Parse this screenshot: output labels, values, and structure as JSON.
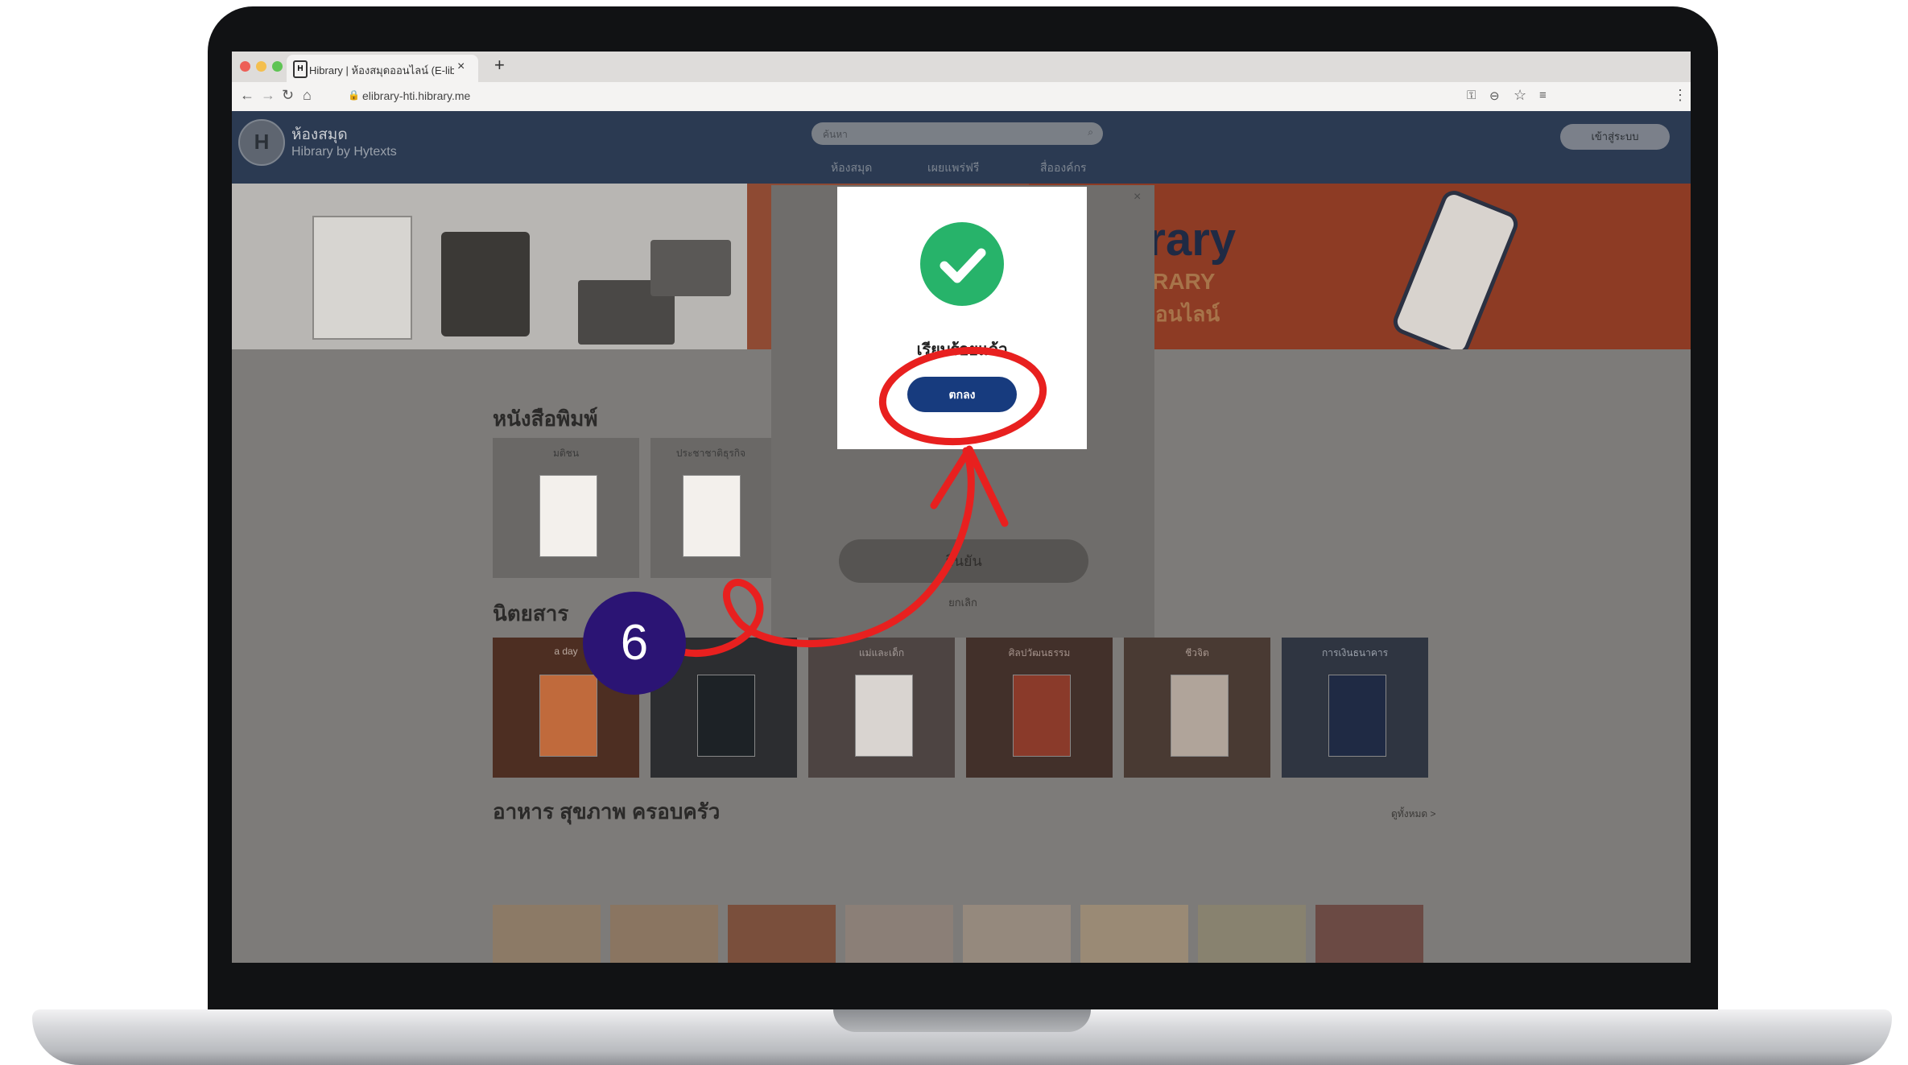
{
  "browser": {
    "tab_title": "Hibrary | ห้องสมุดออนไลน์ (E-lib",
    "url": "elibrary-hti.hibrary.me",
    "new_tab": "+",
    "close": "×",
    "favicon": "H"
  },
  "site": {
    "logo_letter": "H",
    "name": "ห้องสมุด",
    "subtitle": "Hibrary by Hytexts",
    "search_placeholder": "ค้นหา",
    "nav": [
      "ห้องสมุด",
      "เผยแพร่ฟรี",
      "สื่อองค์กร"
    ],
    "login_label": "เข้าสู่ระบบ"
  },
  "banner": {
    "brand": "Hibrary",
    "headline": "E-LIBRARY",
    "subline": "ห้องสมุดออนไลน์"
  },
  "sections": {
    "printed": {
      "title": "หนังสือพิมพ์",
      "cards": [
        "มติชน",
        "ประชาชาติธุรกิจ"
      ]
    },
    "magazines": {
      "title": "นิตยสาร",
      "cards": [
        "a day",
        "",
        "แม่และเด็ก",
        "ศิลปวัฒนธรรม",
        "ชีวจิต",
        "การเงินธนาคาร"
      ]
    },
    "food": {
      "title": "อาหาร สุขภาพ ครอบครัว",
      "see_all": "ดูทั้งหมด >"
    }
  },
  "login_panel": {
    "submit_label": "ยืนยัน",
    "cancel_label": "ยกเลิก"
  },
  "success_dialog": {
    "message": "เรียบร้อยแล้ว",
    "ok_label": "ตกลง"
  },
  "annotation": {
    "step_number": "6",
    "color": "#e8201f",
    "badge_color": "#2b1474"
  },
  "colors": {
    "header": "#2b3a52",
    "ok_button": "#173b7e",
    "success_check": "#27b36a"
  }
}
